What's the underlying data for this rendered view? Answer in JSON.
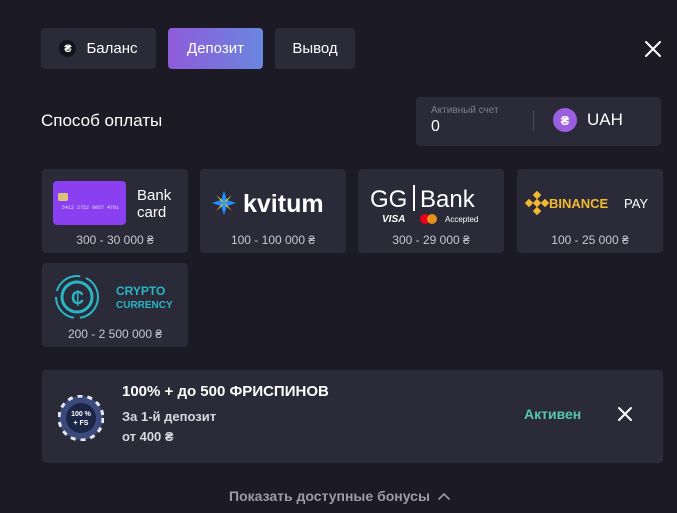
{
  "tabs": [
    {
      "label": "Баланс",
      "coin": "₴"
    },
    {
      "label": "Депозит"
    },
    {
      "label": "Вывод"
    }
  ],
  "section_title": "Способ оплаты",
  "account": {
    "label": "Активный счет",
    "value": "0",
    "currency": "UAH",
    "currency_symbol": "₴"
  },
  "methods": [
    {
      "name": "Bank card",
      "line1": "Bank",
      "line2": "card",
      "range": "300 - 30 000 ₴",
      "card_text": "5412 2752 0057 4701"
    },
    {
      "name": "kvitum",
      "range": "100 - 100 000 ₴"
    },
    {
      "name": "GG|Bank",
      "brand_left": "GG",
      "brand_right": "Bank",
      "visa": "VISA",
      "accepted": "Accepted",
      "range": "300 - 29 000 ₴"
    },
    {
      "name": "BINANCE PAY",
      "brand": "BINANCE",
      "pay": "PAY",
      "range": "100 - 25 000 ₴"
    },
    {
      "name": "CRYPTO CURRENCY",
      "line1": "CRYPTO",
      "line2": "CURRENCY",
      "range": "200 - 2 500 000 ₴"
    }
  ],
  "bonus": {
    "title": "100% + до 500 ФРИСПИНОВ",
    "line1": "За 1-й депозит",
    "line2": "от 400 ₴",
    "status": "Активен",
    "chip_text1": "100 %",
    "chip_text2": "+ FS"
  },
  "show_bonuses": "Показать доступные бонусы",
  "colors": {
    "accent_from": "#8e5bdb",
    "accent_to": "#6a86de",
    "status": "#55c7b0",
    "panel": "#2b2a38",
    "background": "#1c1b25"
  }
}
